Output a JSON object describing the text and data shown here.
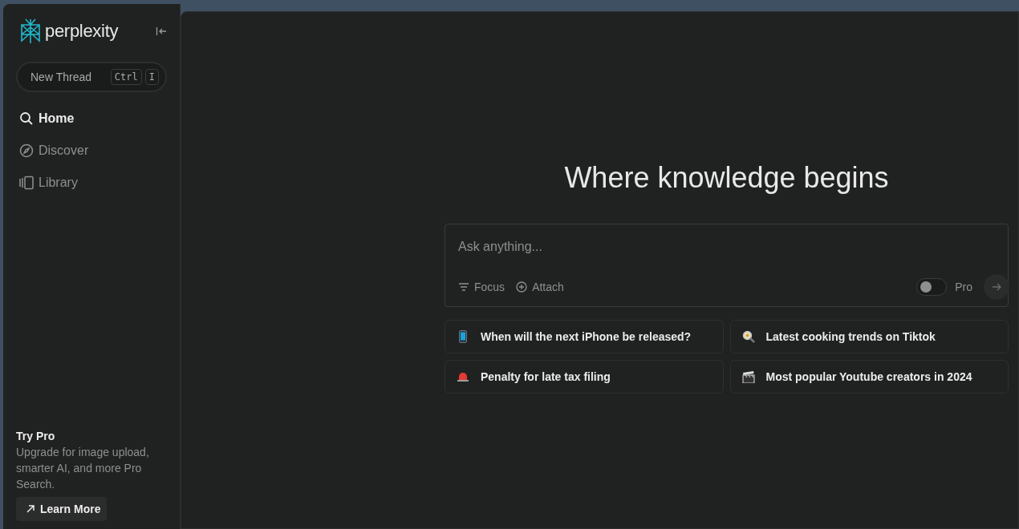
{
  "sidebar": {
    "logo_text": "perplexity",
    "new_thread": {
      "label": "New Thread",
      "keys": [
        "Ctrl",
        "I"
      ]
    },
    "items": [
      {
        "label": "Home",
        "selected": true
      },
      {
        "label": "Discover",
        "selected": false
      },
      {
        "label": "Library",
        "selected": false
      }
    ],
    "promo": {
      "title": "Try Pro",
      "text": "Upgrade for image upload, smarter AI, and more Pro Search.",
      "button": "Learn More"
    }
  },
  "main": {
    "heading": "Where knowledge begins",
    "search": {
      "placeholder": "Ask anything...",
      "focus": "Focus",
      "attach": "Attach",
      "pro_label": "Pro",
      "pro_on": false
    },
    "suggestions": [
      {
        "text": "When will the next iPhone be released?"
      },
      {
        "text": "Latest cooking trends on Tiktok"
      },
      {
        "text": "Penalty for late tax filing"
      },
      {
        "text": "Most popular Youtube creators in 2024"
      }
    ]
  }
}
